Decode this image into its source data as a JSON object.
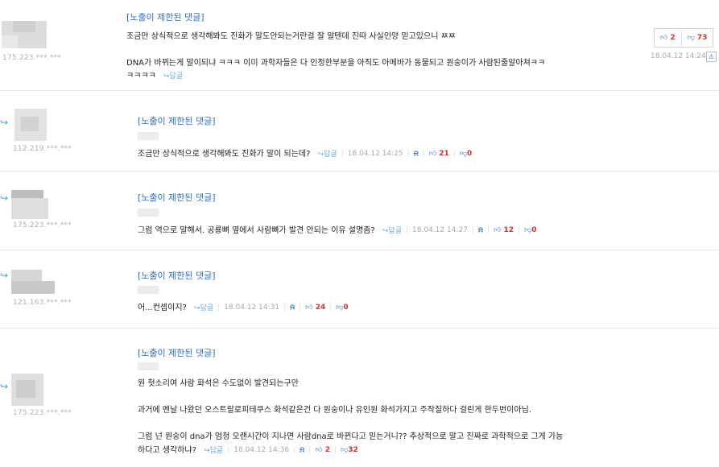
{
  "restricted_label": "[노출이 제한된 댓글]",
  "reply_link": "↪답글",
  "top_comment": {
    "ip": "175.223.***.***",
    "line1": "조금만 상식적으로 생각해봐도 진화가 말도안되는거란걸 잘 알텐데 진따 사실인양 믿고있으니 ㅉㅉ",
    "line2": "DNA가 바뀌는게 말이되냐 ㅋㅋㅋ 이미 과학자들은 다 인정한부분을 아직도 아메바가 동물되고 원숭이가 사람된줄알아쳐ㅋㅋ",
    "line3": "ㅋㅋㅋㅋ",
    "up": "2",
    "down": "73",
    "date": "18.04.12 14:24"
  },
  "replies": [
    {
      "ip": "112.219.***.***",
      "lines": [
        "조금만 상식적으로 생각해봐도 진화가 말이 되는데?"
      ],
      "date": "18.04.12 14:25",
      "up": "21",
      "down": "0"
    },
    {
      "ip": "175.223.***.***",
      "lines": [
        "그럼 역으로 말해서. 공룡뼈 옆에서 사람뼈가 발견 안되는 이유 설명좀?"
      ],
      "date": "18.04.12 14:27",
      "up": "12",
      "down": "0"
    },
    {
      "ip": "121.163.***.***",
      "lines": [
        "어...컨셉이지?"
      ],
      "date": "18.04.12 14:31",
      "up": "24",
      "down": "0"
    },
    {
      "ip": "175.223.***.***",
      "lines": [
        "뭔 헛소리여 사람 화석은 수도없이 발견되는구만",
        "과거에 멘날 나왔던 오스트랄로피테쿠스 화석같은건 다 원숭이나 유인원 화석가지고 주작질하다 걸린게 한두번이아님.",
        "그럼 넌 원숭이 dna가 엄청 오랜시간이 지나면 사람dna로 바뀐다고 믿는거니?? 추상적으로 말고 진짜로 과학적으로 그게 가능",
        "하다고 생각하냐?"
      ],
      "date": "18.04.12 14:36",
      "up": "2",
      "down": "32"
    }
  ]
}
